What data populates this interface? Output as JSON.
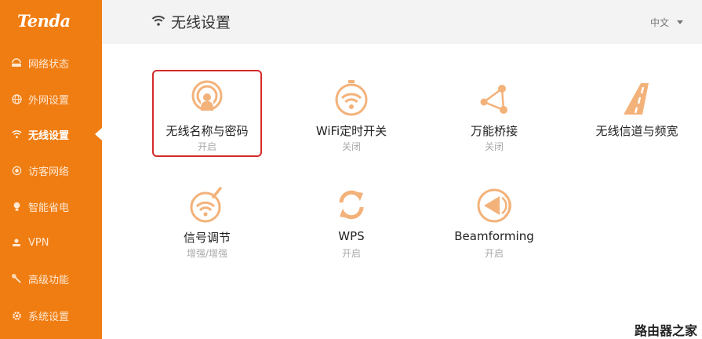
{
  "brand": {
    "logo": "Tenda",
    "accent": "#f07d12"
  },
  "sidebar": {
    "items": [
      {
        "label": "网络状态",
        "icon": "router-status-icon"
      },
      {
        "label": "外网设置",
        "icon": "globe-icon"
      },
      {
        "label": "无线设置",
        "icon": "wifi-icon",
        "active": true
      },
      {
        "label": "访客网络",
        "icon": "guest-signal-icon"
      },
      {
        "label": "智能省电",
        "icon": "lightbulb-icon"
      },
      {
        "label": "VPN",
        "icon": "vpn-icon"
      },
      {
        "label": "高级功能",
        "icon": "tools-icon"
      },
      {
        "label": "系统设置",
        "icon": "gear-icon"
      }
    ]
  },
  "header": {
    "title": "无线设置",
    "language": "中文"
  },
  "tiles": [
    {
      "label": "无线名称与密码",
      "status": "开启",
      "icon": "wifi-name-password-icon",
      "selected": true
    },
    {
      "label": "WiFi定时开关",
      "status": "关闭",
      "icon": "wifi-timer-icon"
    },
    {
      "label": "万能桥接",
      "status": "关闭",
      "icon": "bridge-icon"
    },
    {
      "label": "无线信道与频宽",
      "status": "",
      "icon": "channel-road-icon"
    },
    {
      "label": "信号调节",
      "status": "增强/增强",
      "icon": "signal-adjust-icon"
    },
    {
      "label": "WPS",
      "status": "开启",
      "icon": "wps-sync-icon"
    },
    {
      "label": "Beamforming",
      "status": "开启",
      "icon": "beamforming-icon"
    }
  ],
  "watermark": "路由器之家"
}
